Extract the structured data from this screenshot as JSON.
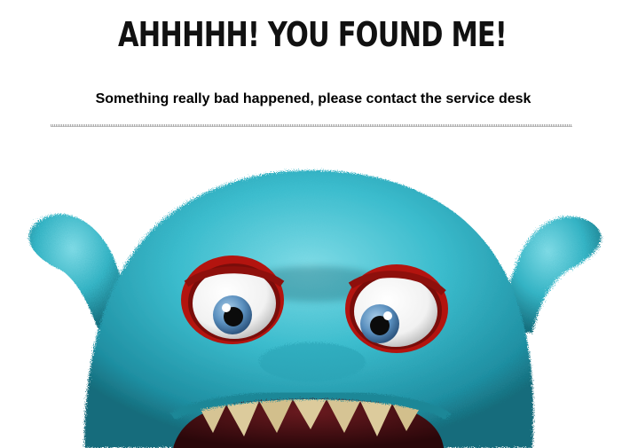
{
  "error_page": {
    "headline": "AHHHHH! YOU FOUND ME!",
    "message": "Something really bad happened, please contact the service desk"
  },
  "colors": {
    "fur": "#35b8c9",
    "fur_dark": "#1d7d8c",
    "fur_light": "#8fe3ec",
    "eye_rim": "#c41a14",
    "iris": "#5b8fbd",
    "teeth": "#d8c79a",
    "mouth": "#3a0d10"
  },
  "icons": {
    "illustration": "furry-monster-illustration"
  }
}
